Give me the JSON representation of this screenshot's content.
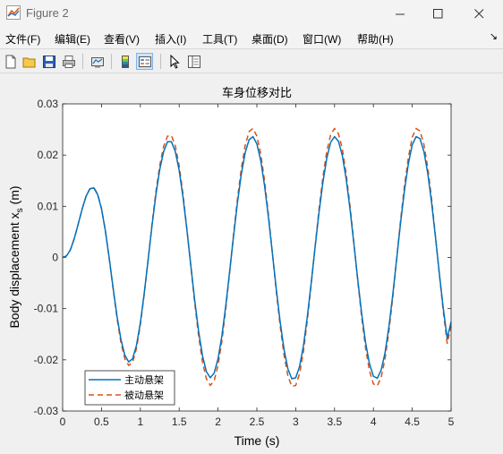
{
  "window": {
    "title": "Figure 2"
  },
  "menu": [
    {
      "label": "文件(F)"
    },
    {
      "label": "编辑(E)"
    },
    {
      "label": "查看(V)"
    },
    {
      "label": "插入(I)"
    },
    {
      "label": "工具(T)"
    },
    {
      "label": "桌面(D)"
    },
    {
      "label": "窗口(W)"
    },
    {
      "label": "帮助(H)"
    }
  ],
  "toolbar_icons": [
    "new-figure-icon",
    "open-file-icon",
    "save-icon",
    "print-icon",
    "link-plot-icon",
    "colorbar-icon",
    "legend-icon",
    "pointer-icon",
    "property-editor-icon"
  ],
  "chart_data": {
    "type": "line",
    "title": "车身位移对比",
    "xlabel": "Time (s)",
    "ylabel_main": "Body displacement x",
    "ylabel_sub": "s",
    "ylabel_unit": " (m)",
    "xlim": [
      0,
      5
    ],
    "ylim": [
      -0.03,
      0.03
    ],
    "xticks": [
      "0",
      "0.5",
      "1",
      "1.5",
      "2",
      "2.5",
      "3",
      "3.5",
      "4",
      "4.5",
      "5"
    ],
    "yticks": [
      "0.03",
      "0.02",
      "0.01",
      "0",
      "-0.01",
      "-0.02",
      "-0.03"
    ],
    "legend_position": "bottom-left",
    "series": [
      {
        "name": "主动悬架",
        "color": "#0072BD",
        "style": "solid",
        "x": [
          0,
          0.05,
          0.1,
          0.15,
          0.2,
          0.25,
          0.3,
          0.35,
          0.4,
          0.45,
          0.5,
          0.55,
          0.6,
          0.65,
          0.7,
          0.75,
          0.8,
          0.85,
          0.9,
          0.95,
          1.0,
          1.05,
          1.1,
          1.15,
          1.2,
          1.25,
          1.3,
          1.35,
          1.4,
          1.45,
          1.5,
          1.55,
          1.6,
          1.65,
          1.7,
          1.75,
          1.8,
          1.85,
          1.9,
          1.95,
          2.0,
          2.05,
          2.1,
          2.15,
          2.2,
          2.25,
          2.3,
          2.35,
          2.4,
          2.45,
          2.5,
          2.55,
          2.6,
          2.65,
          2.7,
          2.75,
          2.8,
          2.85,
          2.9,
          2.95,
          3.0,
          3.05,
          3.1,
          3.15,
          3.2,
          3.25,
          3.3,
          3.35,
          3.4,
          3.45,
          3.5,
          3.55,
          3.6,
          3.65,
          3.7,
          3.75,
          3.8,
          3.85,
          3.9,
          3.95,
          4.0,
          4.05,
          4.1,
          4.15,
          4.2,
          4.25,
          4.3,
          4.35,
          4.4,
          4.45,
          4.5,
          4.55,
          4.6,
          4.65,
          4.7,
          4.75,
          4.8,
          4.85,
          4.9,
          4.95,
          5.0
        ],
        "y": [
          0.0,
          0.0003,
          0.0015,
          0.0037,
          0.0065,
          0.0094,
          0.0119,
          0.0134,
          0.0136,
          0.0123,
          0.0095,
          0.0052,
          -0.0002,
          -0.006,
          -0.0115,
          -0.016,
          -0.0191,
          -0.0204,
          -0.0198,
          -0.0172,
          -0.0128,
          -0.007,
          -0.0005,
          0.0062,
          0.0122,
          0.0172,
          0.0207,
          0.0226,
          0.0226,
          0.0207,
          0.017,
          0.0117,
          0.0053,
          -0.0016,
          -0.0084,
          -0.0144,
          -0.0192,
          -0.0223,
          -0.0235,
          -0.0226,
          -0.0198,
          -0.0153,
          -0.0094,
          -0.0027,
          0.0042,
          0.0107,
          0.0163,
          0.0205,
          0.023,
          0.0236,
          0.0222,
          0.0189,
          0.0139,
          0.0077,
          0.0008,
          -0.0062,
          -0.0126,
          -0.018,
          -0.0218,
          -0.0237,
          -0.0235,
          -0.0213,
          -0.0172,
          -0.0115,
          -0.0049,
          0.0021,
          0.0088,
          0.0147,
          0.0194,
          0.0225,
          0.0236,
          0.0227,
          0.0199,
          0.0153,
          0.0093,
          0.0025,
          -0.0045,
          -0.0111,
          -0.0167,
          -0.0208,
          -0.0232,
          -0.0236,
          -0.022,
          -0.0186,
          -0.0135,
          -0.0072,
          -0.0002,
          0.0068,
          0.0131,
          0.0183,
          0.022,
          0.0236,
          0.0232,
          0.0207,
          0.0164,
          0.0106,
          0.0038,
          -0.0033,
          -0.01,
          -0.0158,
          -0.0126
        ]
      },
      {
        "name": "被动悬架",
        "color": "#D95319",
        "style": "dashed",
        "x": [
          0,
          0.05,
          0.1,
          0.15,
          0.2,
          0.25,
          0.3,
          0.35,
          0.4,
          0.45,
          0.5,
          0.55,
          0.6,
          0.65,
          0.7,
          0.75,
          0.8,
          0.85,
          0.9,
          0.95,
          1.0,
          1.05,
          1.1,
          1.15,
          1.2,
          1.25,
          1.3,
          1.35,
          1.4,
          1.45,
          1.5,
          1.55,
          1.6,
          1.65,
          1.7,
          1.75,
          1.8,
          1.85,
          1.9,
          1.95,
          2.0,
          2.05,
          2.1,
          2.15,
          2.2,
          2.25,
          2.3,
          2.35,
          2.4,
          2.45,
          2.5,
          2.55,
          2.6,
          2.65,
          2.7,
          2.75,
          2.8,
          2.85,
          2.9,
          2.95,
          3.0,
          3.05,
          3.1,
          3.15,
          3.2,
          3.25,
          3.3,
          3.35,
          3.4,
          3.45,
          3.5,
          3.55,
          3.6,
          3.65,
          3.7,
          3.75,
          3.8,
          3.85,
          3.9,
          3.95,
          4.0,
          4.05,
          4.1,
          4.15,
          4.2,
          4.25,
          4.3,
          4.35,
          4.4,
          4.45,
          4.5,
          4.55,
          4.6,
          4.65,
          4.7,
          4.75,
          4.8,
          4.85,
          4.9,
          4.95,
          5.0
        ],
        "y": [
          0.0,
          0.0003,
          0.0015,
          0.0037,
          0.0065,
          0.0094,
          0.0119,
          0.0134,
          0.0137,
          0.0124,
          0.0096,
          0.0052,
          -0.0003,
          -0.0062,
          -0.0119,
          -0.0166,
          -0.0198,
          -0.0211,
          -0.0205,
          -0.0178,
          -0.0132,
          -0.0072,
          -0.0005,
          0.0065,
          0.0128,
          0.018,
          0.0217,
          0.0237,
          0.0238,
          0.0218,
          0.0179,
          0.0123,
          0.0055,
          -0.0017,
          -0.0089,
          -0.0153,
          -0.0204,
          -0.0237,
          -0.025,
          -0.0241,
          -0.0211,
          -0.0163,
          -0.01,
          -0.0029,
          0.0045,
          0.0114,
          0.0174,
          0.0219,
          0.0246,
          0.0252,
          0.0237,
          0.0202,
          0.0149,
          0.0082,
          0.0008,
          -0.0066,
          -0.0134,
          -0.0191,
          -0.0232,
          -0.0252,
          -0.025,
          -0.0227,
          -0.0183,
          -0.0122,
          -0.0052,
          0.0022,
          0.0094,
          0.0157,
          0.0207,
          0.024,
          0.0252,
          0.0242,
          0.0212,
          0.0163,
          0.0099,
          0.0027,
          -0.0048,
          -0.0118,
          -0.0178,
          -0.0222,
          -0.0247,
          -0.0251,
          -0.0234,
          -0.0198,
          -0.0144,
          -0.0077,
          -0.0002,
          0.0073,
          0.014,
          0.0195,
          0.0235,
          0.0252,
          0.0247,
          0.0221,
          0.0175,
          0.0113,
          0.004,
          -0.0035,
          -0.0106,
          -0.0168,
          -0.0134
        ]
      }
    ]
  }
}
